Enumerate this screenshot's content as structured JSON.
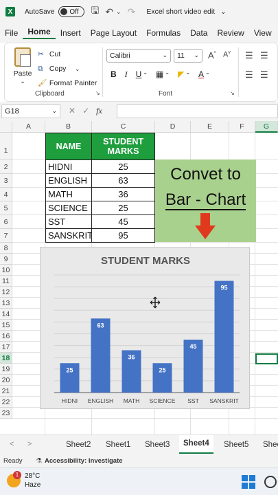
{
  "titlebar": {
    "logo": "X",
    "autosave_label": "AutoSave",
    "toggle_label": "Off",
    "title": "Excel short video edit",
    "icons": [
      "save-icon",
      "undo-icon",
      "redo-icon"
    ]
  },
  "ribbon_tabs": [
    "File",
    "Home",
    "Insert",
    "Page Layout",
    "Formulas",
    "Data",
    "Review",
    "View"
  ],
  "active_tab": "Home",
  "clipboard": {
    "paste_label": "Paste",
    "cut_label": "Cut",
    "copy_label": "Copy",
    "format_painter_label": "Format Painter",
    "group_label": "Clipboard"
  },
  "font_group": {
    "font_name": "Calibri",
    "font_size": "11",
    "bold": "B",
    "italic": "I",
    "underline": "U",
    "group_label": "Font"
  },
  "formula_bar": {
    "name_box": "G18",
    "fx_label": "fx",
    "formula": ""
  },
  "grid": {
    "columns": [
      "A",
      "B",
      "C",
      "D",
      "E",
      "F",
      "G"
    ],
    "rows": [
      "1",
      "2",
      "3",
      "4",
      "5",
      "6",
      "7",
      "8",
      "9",
      "10",
      "11",
      "12",
      "13",
      "14",
      "15",
      "16",
      "17",
      "18",
      "19",
      "20",
      "21",
      "22",
      "23"
    ],
    "selected_row": "18",
    "selected_col": "G"
  },
  "table": {
    "header_name": "NAME",
    "header_marks": "STUDENT MARKS",
    "rows": [
      {
        "name": "HIDNI",
        "marks": "25"
      },
      {
        "name": "ENGLISH",
        "marks": "63"
      },
      {
        "name": "MATH",
        "marks": "36"
      },
      {
        "name": "SCIENCE",
        "marks": "25"
      },
      {
        "name": "SST",
        "marks": "45"
      },
      {
        "name": "SANSKRIT",
        "marks": "95"
      }
    ]
  },
  "callout": {
    "line1": "Convet to",
    "line2": "Bar - Chart"
  },
  "chart_data": {
    "type": "bar",
    "title": "STUDENT MARKS",
    "categories": [
      "HIDNI",
      "ENGLISH",
      "MATH",
      "SCIENCE",
      "SST",
      "SANSKRIT"
    ],
    "values": [
      25,
      63,
      36,
      25,
      45,
      95
    ],
    "ylim": [
      0,
      100
    ],
    "grid": true,
    "data_labels": true,
    "bar_color": "#4472c4",
    "xlabel": "",
    "ylabel": ""
  },
  "sheet_tabs": [
    "Sheet2",
    "Sheet1",
    "Sheet3",
    "Sheet4",
    "Sheet5",
    "Shee"
  ],
  "active_sheet": "Sheet4",
  "status": {
    "ready": "Ready",
    "accessibility": "Accessibility: Investigate"
  },
  "taskbar": {
    "temperature": "28°C",
    "weather": "Haze",
    "badge": "1"
  },
  "colors": {
    "excel_green": "#107c41",
    "table_header": "#1f9e3e",
    "callout_bg": "#a9d18e",
    "arrow": "#e03a1e"
  }
}
